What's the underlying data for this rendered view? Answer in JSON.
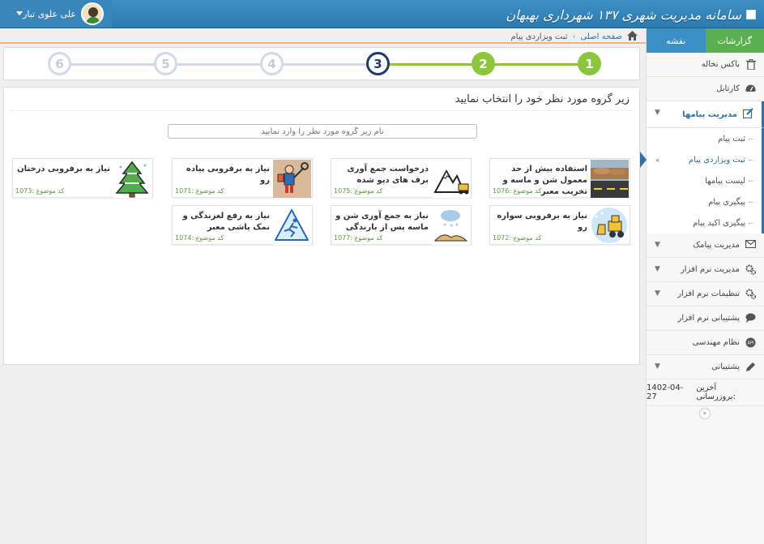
{
  "header": {
    "brand_title": "سامانه مدیریت شهری ۱۳۷ شهرداری بهبهان",
    "user_name": "علی علوی تبار"
  },
  "sidebar": {
    "tabs": [
      {
        "label": "گزارشات"
      },
      {
        "label": "نقشه"
      }
    ],
    "items": [
      {
        "label": "باکس نخاله",
        "icon": "trash-icon"
      },
      {
        "label": "کارتابل",
        "icon": "dashboard-icon"
      },
      {
        "label": "مدیریت پیامها",
        "icon": "edit-icon"
      },
      {
        "label": "مدیریت پیامک",
        "icon": "envelope-icon"
      },
      {
        "label": "مدیریت نرم افزار",
        "icon": "gears-icon"
      },
      {
        "label": "تنظیمات نرم افزار",
        "icon": "gears-icon"
      },
      {
        "label": "پشتیبانی نرم افزار",
        "icon": "comment-icon"
      },
      {
        "label": "نظام مهندسی",
        "icon": "api-icon"
      },
      {
        "label": "پشتیبانی",
        "icon": "pencil-icon"
      }
    ],
    "sub_items": [
      {
        "label": "ثبت پیام"
      },
      {
        "label": "ثبت ویزاردی پیام"
      },
      {
        "label": "لیست پیامها"
      },
      {
        "label": "پیگیری پیام"
      },
      {
        "label": "پیگیری اکید پیام"
      }
    ],
    "last_update_label": "آخرین بروزرسانی:",
    "last_update_date": "1402-04-27",
    "collapse_symbol": "»"
  },
  "breadcrumb": {
    "home": "صفحه اصلی",
    "separator": "‹",
    "current": "ثبت ویزاردی پیام"
  },
  "wizard": {
    "steps": [
      "1",
      "2",
      "3",
      "4",
      "5",
      "6"
    ],
    "current_step": 3,
    "colors": {
      "done": "#8cc63f",
      "current": "#1f3a6e",
      "todo": "#d3d9e6"
    }
  },
  "panel": {
    "title": "زیر گروه مورد نظر خود را انتخاب نمایید",
    "search_placeholder": "نام زیر گروه مورد نظر را وارد نمایید"
  },
  "cards": [
    {
      "title": "استفاده بیش از حد معمول شن و ماسه و تخریب معبر",
      "code": "کد موضوع :1076",
      "icon": "road-sand-icon"
    },
    {
      "title": "درخواست جمع آوری برف های دپو شده",
      "code": "کد موضوع :1075",
      "icon": "snow-pile-loader-icon"
    },
    {
      "title": "نیاز به برفروبی پیاده رو",
      "code": "کد موضوع :1071",
      "icon": "sidewalk-shoveling-icon"
    },
    {
      "title": "نیاز به برفروبی درختان",
      "code": "کد موضوع :1073",
      "icon": "snowy-tree-icon"
    },
    {
      "title": "نیاز به برفروبی سواره رو",
      "code": "کد موضوع :1072",
      "icon": "snowplow-icon"
    },
    {
      "title": "نیاز به جمع آوری شن و ماسه پس از بارندگی",
      "code": "کد موضوع :1077",
      "icon": "rain-sand-icon"
    },
    {
      "title": "نیاز به رفع لغزندگی و نمک پاشی معبر",
      "code": "کد موضوع :1074",
      "icon": "slippery-sign-icon"
    }
  ]
}
